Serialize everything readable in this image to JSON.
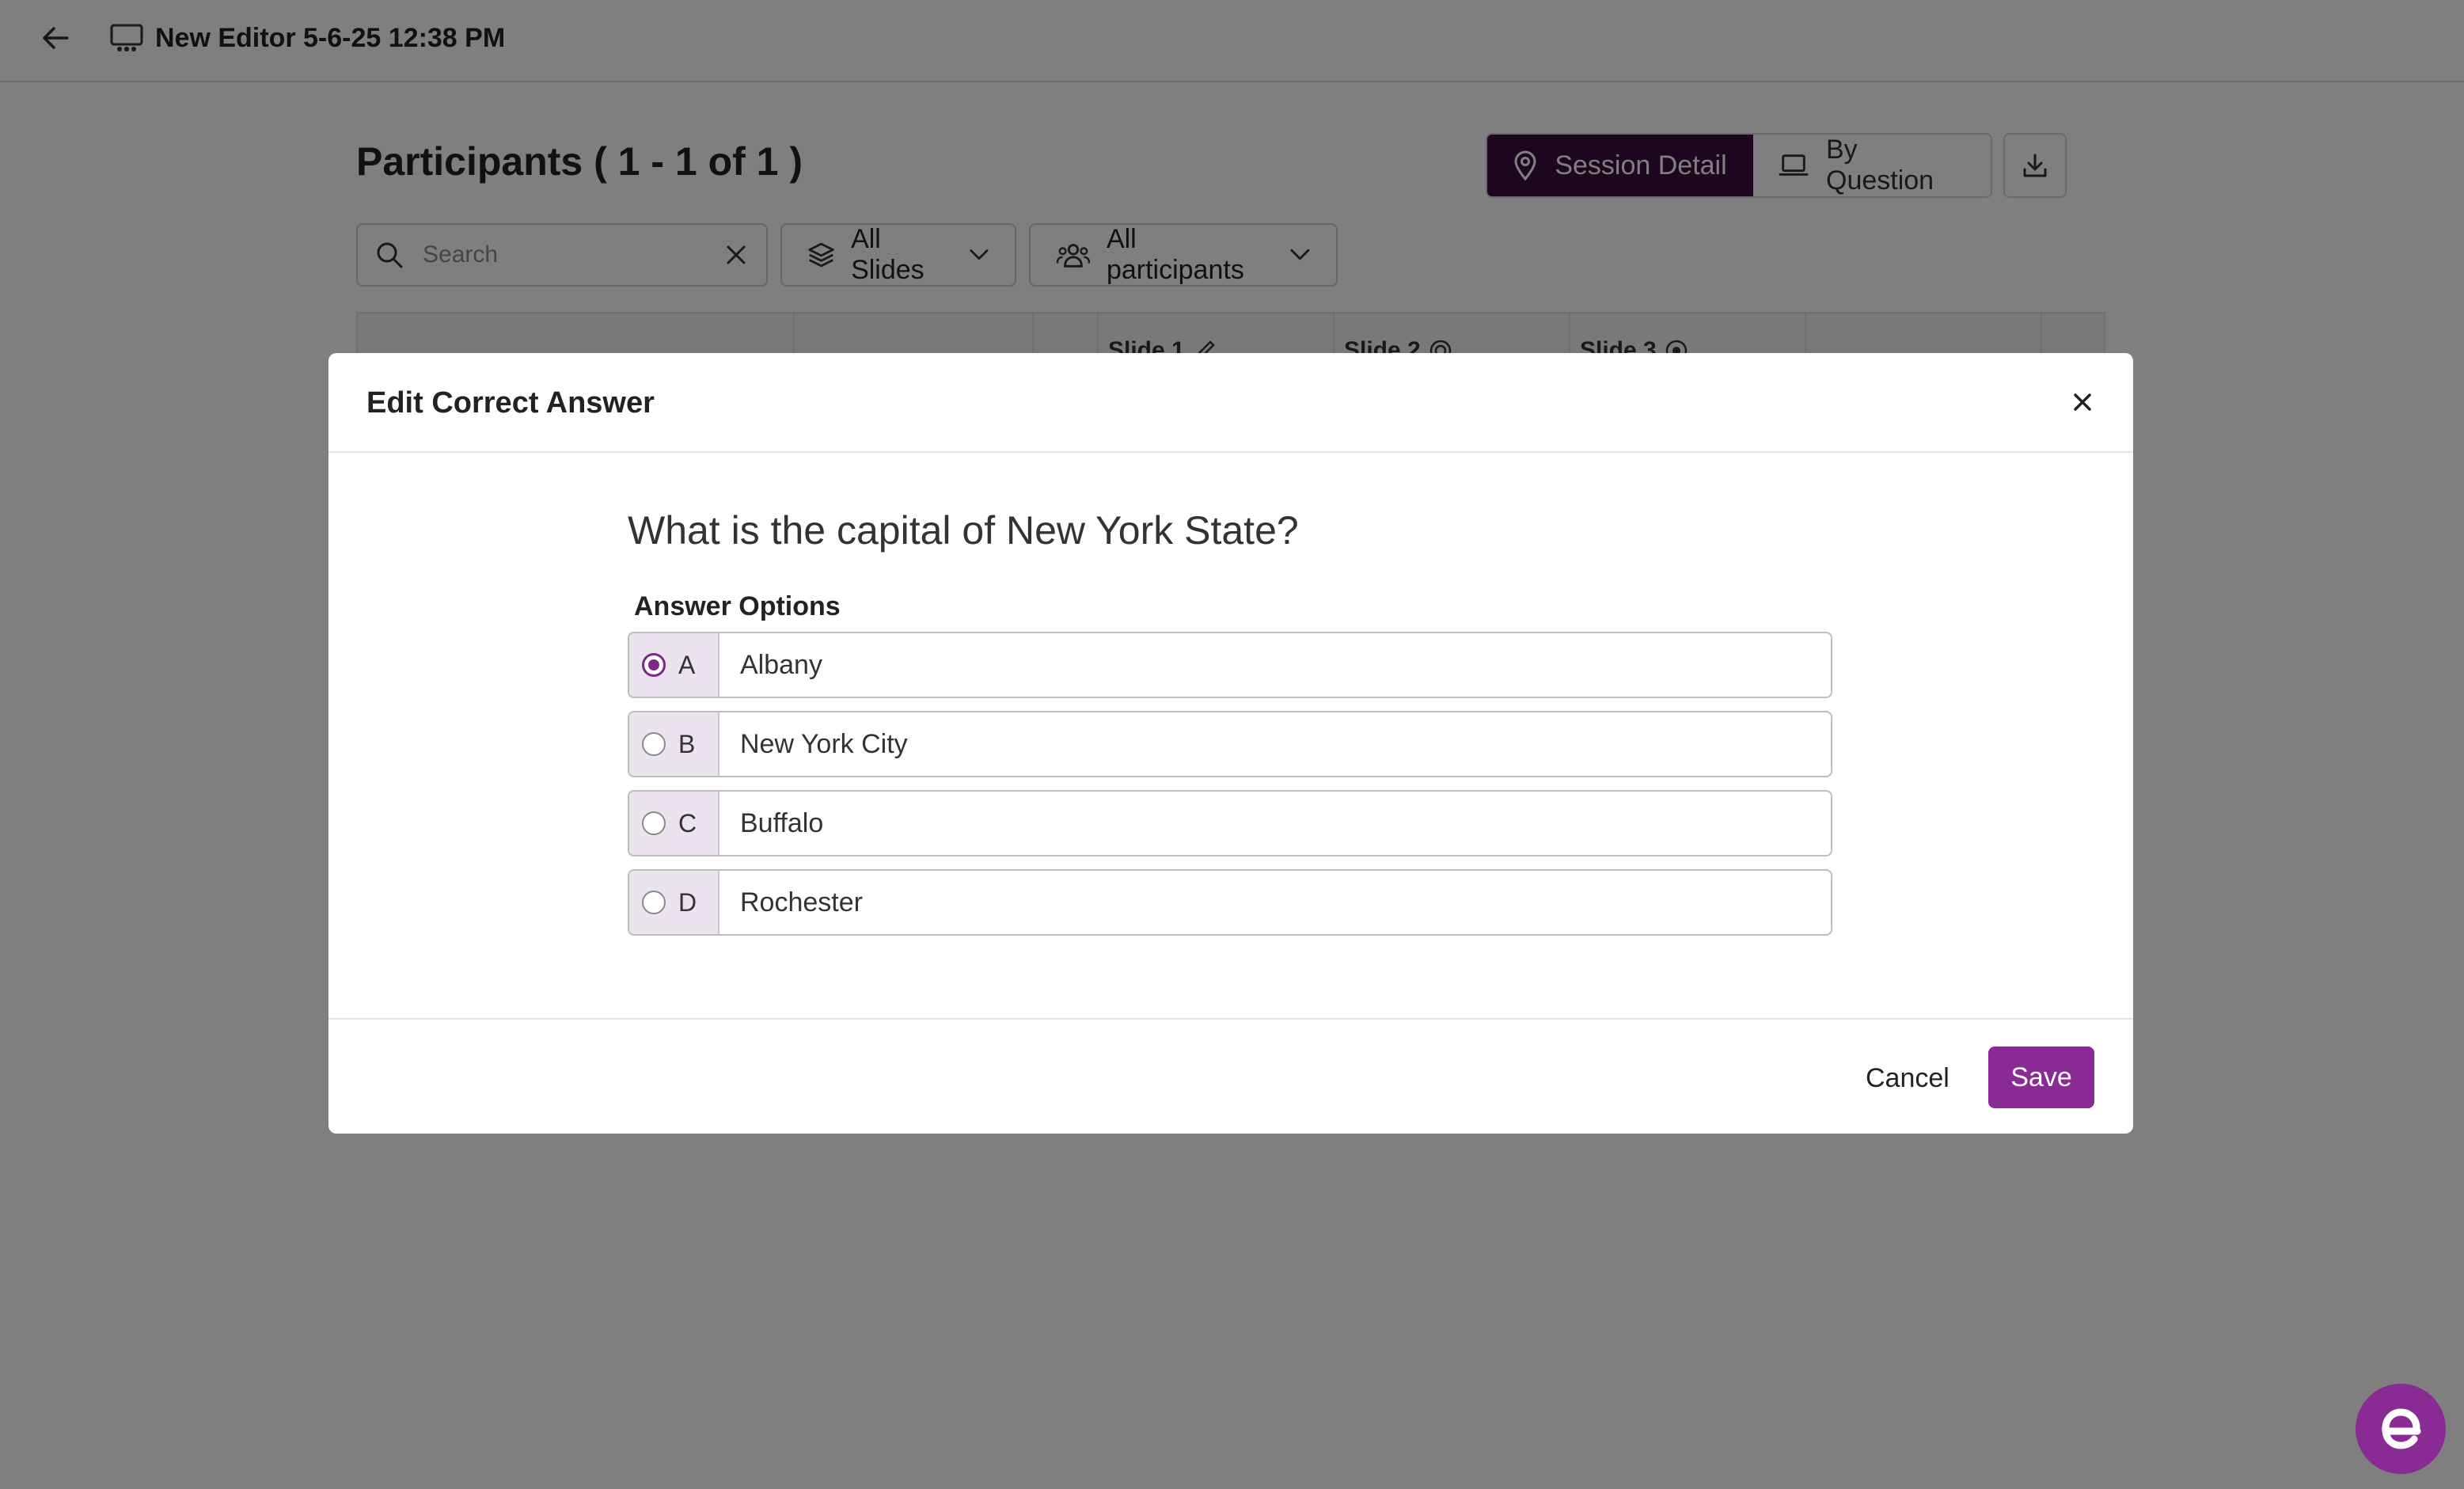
{
  "app": {
    "title": "New Editor 5-6-25 12:38 PM"
  },
  "participants": {
    "title": "Participants ( 1 - 1 of 1 )",
    "view_toggle": {
      "session_detail": "Session Detail",
      "by_question": "By Question"
    },
    "search": {
      "placeholder": "Search",
      "value": ""
    },
    "filters": {
      "slides": "All Slides",
      "participants": "All participants"
    },
    "table_columns": [
      "Slide 1",
      "Slide 2",
      "Slide 3"
    ]
  },
  "modal": {
    "title": "Edit Correct Answer",
    "question": "What is the capital of New York State?",
    "options_label": "Answer Options",
    "options": [
      {
        "letter": "A",
        "text": "Albany",
        "selected": true
      },
      {
        "letter": "B",
        "text": "New York City",
        "selected": false
      },
      {
        "letter": "C",
        "text": "Buffalo",
        "selected": false
      },
      {
        "letter": "D",
        "text": "Rochester",
        "selected": false
      }
    ],
    "cancel_label": "Cancel",
    "save_label": "Save"
  },
  "colors": {
    "brand_purple": "#8a2a94",
    "active_toggle": "#3b0f3d",
    "overlay": "rgba(0,0,0,0.5)"
  }
}
